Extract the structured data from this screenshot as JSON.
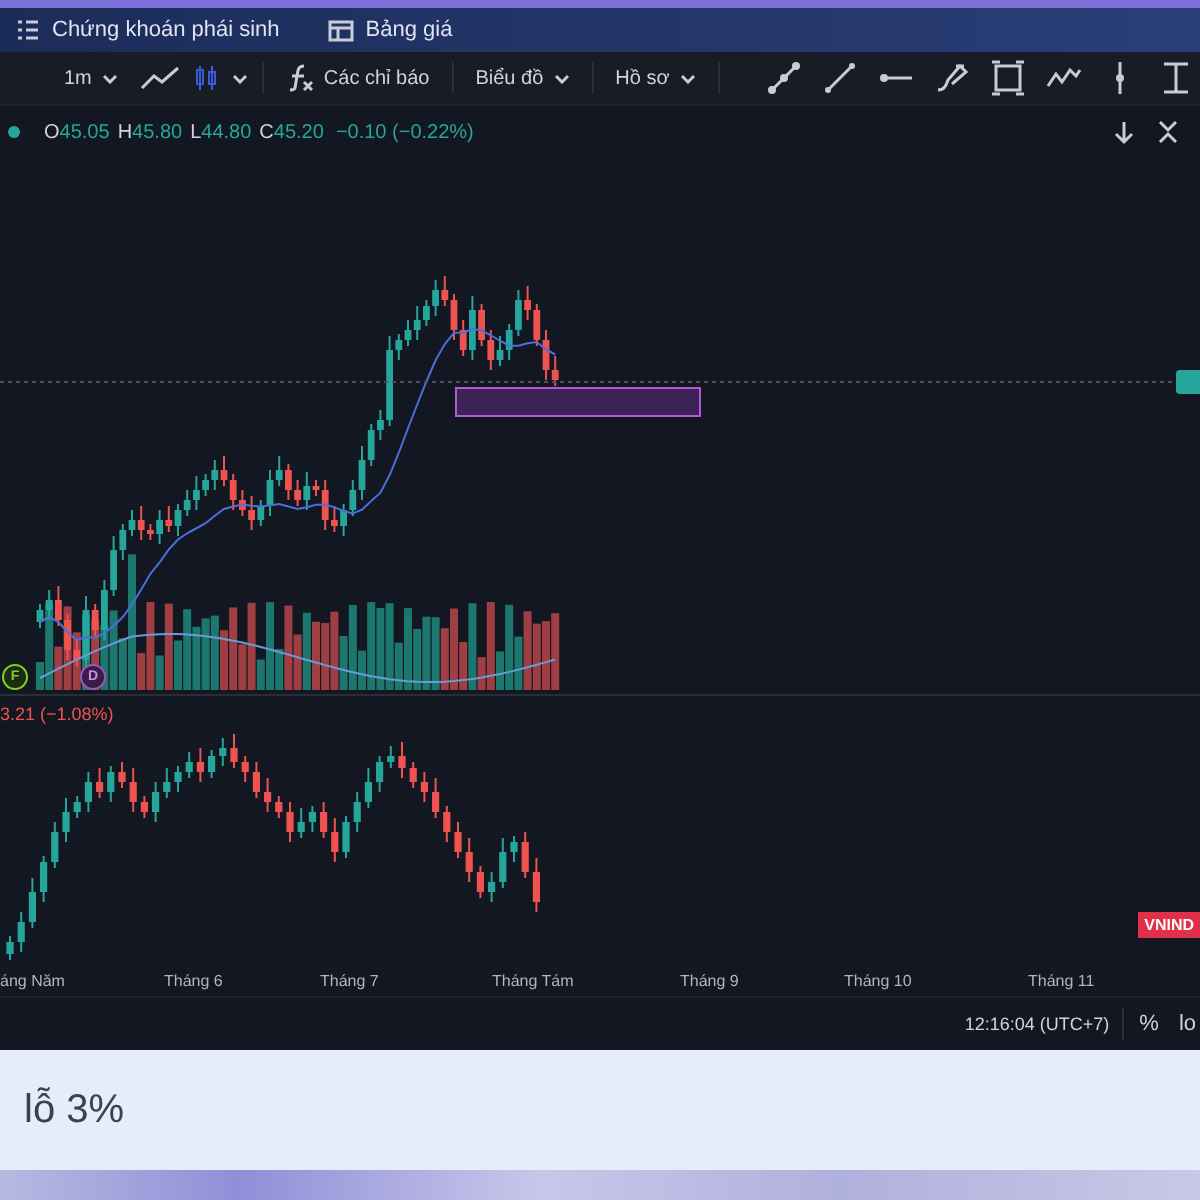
{
  "top_tabs": [
    {
      "label": "Chứng khoán phái sinh"
    },
    {
      "label": "Bảng giá"
    }
  ],
  "toolbar": [
    {
      "kind": "dropdown",
      "label": "1m"
    },
    {
      "kind": "indicators",
      "label": "Các chỉ báo"
    },
    {
      "kind": "dropdown",
      "label": "Biểu đồ"
    },
    {
      "kind": "dropdown",
      "label": "Hồ sơ"
    }
  ],
  "legend": {
    "values": [
      {
        "label": "O",
        "value": "45.05"
      },
      {
        "label": "H",
        "value": "45.80"
      },
      {
        "label": "L",
        "value": "44.80"
      },
      {
        "label": "C",
        "value": "45.20"
      }
    ],
    "change": "−0.10 (−0.22%)"
  },
  "markers": [
    {
      "label": "F"
    },
    {
      "label": "D"
    }
  ],
  "indicator_pane": {
    "reading": "3.21 (−1.08%)",
    "badge": "VNIND"
  },
  "time_axis": [
    "áng Năm",
    "Tháng 6",
    "Tháng 7",
    "Tháng Tám",
    "Tháng 9",
    "Tháng 10",
    "Tháng 11"
  ],
  "status_bar": {
    "time": "12:16:04 (UTC+7)",
    "items": [
      "%",
      "lo"
    ]
  },
  "note": {
    "text": "lỗ 3%"
  }
}
